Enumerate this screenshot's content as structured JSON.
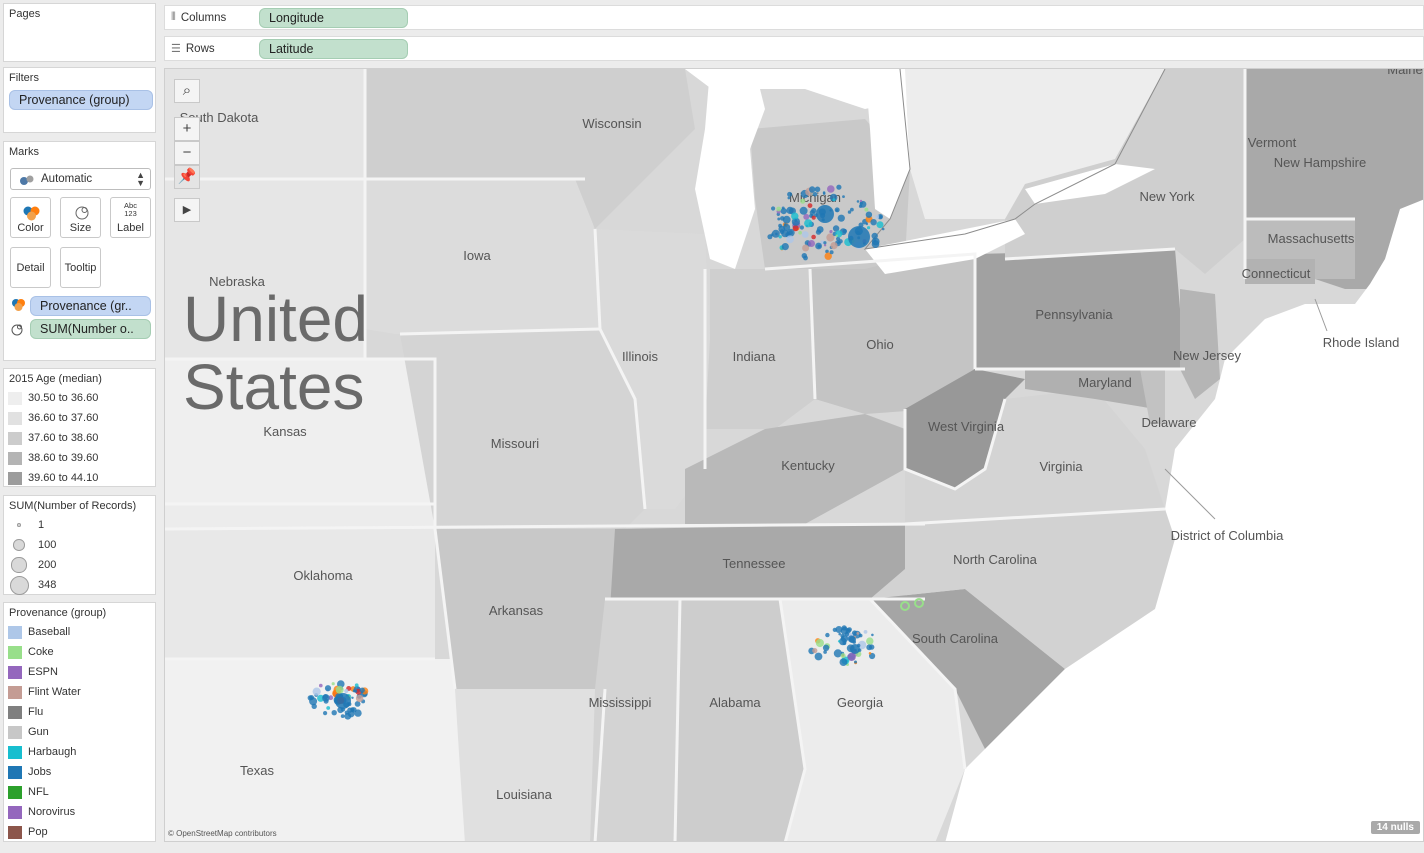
{
  "panels": {
    "pages": {
      "title": "Pages"
    },
    "filters": {
      "title": "Filters",
      "pill": "Provenance (group)"
    },
    "marks": {
      "title": "Marks",
      "mark_type": "Automatic",
      "buttons": {
        "color": "Color",
        "size": "Size",
        "label": "Label",
        "detail": "Detail",
        "tooltip": "Tooltip"
      },
      "label_icon_text": "Abc\n123",
      "encodings": [
        {
          "icon": "color-icon",
          "field": "Provenance (gr.."
        },
        {
          "icon": "size-icon",
          "field": "SUM(Number o.."
        }
      ]
    },
    "age_legend": {
      "title": "2015 Age (median)",
      "items": [
        {
          "label": "30.50 to 36.60",
          "color": "#eeeeee"
        },
        {
          "label": "36.60 to 37.60",
          "color": "#e1e1e1"
        },
        {
          "label": "37.60 to 38.60",
          "color": "#cccccc"
        },
        {
          "label": "38.60 to 39.60",
          "color": "#b4b4b4"
        },
        {
          "label": "39.60 to 44.10",
          "color": "#9c9c9c"
        }
      ]
    },
    "size_legend": {
      "title": "SUM(Number of Records)",
      "items": [
        {
          "label": "1",
          "value": 1
        },
        {
          "label": "100",
          "value": 100
        },
        {
          "label": "200",
          "value": 200
        },
        {
          "label": "348",
          "value": 348
        }
      ]
    },
    "provenance_legend": {
      "title": "Provenance (group)",
      "items": [
        {
          "label": "Baseball",
          "color": "#aec7e8"
        },
        {
          "label": "Coke",
          "color": "#98df8a"
        },
        {
          "label": "ESPN",
          "color": "#9467bd"
        },
        {
          "label": "Flint Water",
          "color": "#c49c94"
        },
        {
          "label": "Flu",
          "color": "#7f7f7f"
        },
        {
          "label": "Gun",
          "color": "#c7c7c7"
        },
        {
          "label": "Harbaugh",
          "color": "#17becf"
        },
        {
          "label": "Jobs",
          "color": "#1f77b4"
        },
        {
          "label": "NFL",
          "color": "#2ca02c"
        },
        {
          "label": "Norovirus",
          "color": "#9467bd"
        },
        {
          "label": "Pop",
          "color": "#8c564b"
        }
      ]
    }
  },
  "shelves": {
    "columns": {
      "label": "Columns",
      "pill": "Longitude"
    },
    "rows": {
      "label": "Rows",
      "pill": "Latitude"
    }
  },
  "map": {
    "country_label": [
      "United",
      "States"
    ],
    "credit": "© OpenStreetMap contributors",
    "nulls": "14 nulls",
    "tool_icons": [
      "search-icon",
      "zoom-in-icon",
      "zoom-out-icon",
      "pin-icon",
      "expand-icon"
    ],
    "state_labels": [
      "South Dakota",
      "Wisconsin",
      "Michigan",
      "New York",
      "Vermont",
      "New Hampshire",
      "Massachusetts",
      "Connecticut",
      "Rhode Island",
      "Nebraska",
      "Iowa",
      "Pennsylvania",
      "New Jersey",
      "Illinois",
      "Indiana",
      "Ohio",
      "Maryland",
      "Delaware",
      "Kansas",
      "West Virginia",
      "Missouri",
      "Kentucky",
      "Virginia",
      "District of Columbia",
      "Tennessee",
      "North Carolina",
      "Oklahoma",
      "Arkansas",
      "South Carolina",
      "Mississippi",
      "Alabama",
      "Georgia",
      "Texas",
      "Louisiana",
      "Maine"
    ],
    "point_clusters": [
      {
        "name": "Michigan (Detroit / Ann Arbor)",
        "main_color": "#1f77b4"
      },
      {
        "name": "Texas (Dallas)",
        "main_color": "#1f77b4"
      },
      {
        "name": "Georgia (Atlanta)",
        "main_color": "#1f77b4"
      },
      {
        "name": "South Carolina",
        "main_color": "#98df8a"
      }
    ]
  }
}
